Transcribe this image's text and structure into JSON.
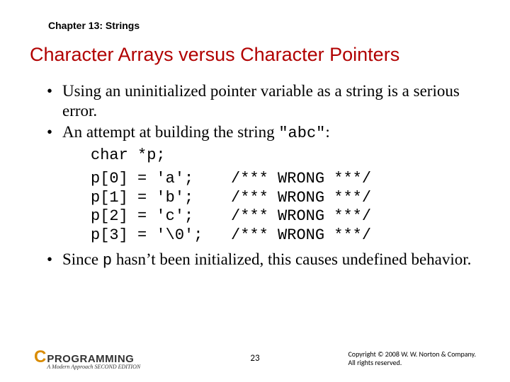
{
  "chapter": "Chapter 13: Strings",
  "title": "Character Arrays versus Character Pointers",
  "bullet1": "Using an uninitialized pointer variable as a string is a serious error.",
  "bullet2_a": "An attempt at building the string ",
  "bullet2_code": "\"abc\"",
  "bullet2_b": ":",
  "code_decl": "char *p;",
  "code_body": "p[0] = 'a';    /*** WRONG ***/\np[1] = 'b';    /*** WRONG ***/\np[2] = 'c';    /*** WRONG ***/\np[3] = '\\0';   /*** WRONG ***/",
  "bullet3_a": "Since ",
  "bullet3_code": "p",
  "bullet3_b": " hasn’t been initialized, this causes undefined behavior.",
  "logo": {
    "c": "C",
    "main": "PROGRAMMING",
    "sub": "A Modern Approach   SECOND EDITION"
  },
  "page_number": "23",
  "copyright_l1": "Copyright © 2008 W. W. Norton & Company.",
  "copyright_l2": "All rights reserved."
}
